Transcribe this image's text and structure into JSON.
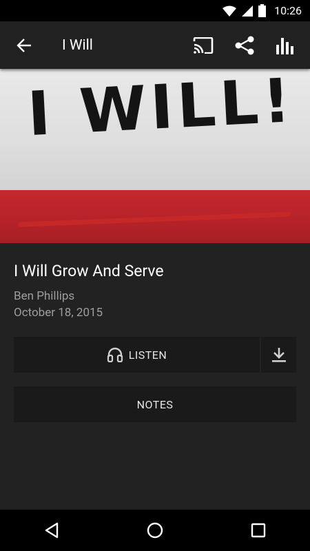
{
  "status_bar": {
    "time": "10:26"
  },
  "app_bar": {
    "title": "I Will"
  },
  "hero": {
    "scribble_text": "I WILL!"
  },
  "sermon": {
    "title": "I Will Grow And Serve",
    "speaker": "Ben Phillips",
    "date": "October 18, 2015"
  },
  "actions": {
    "listen_label": "LISTEN",
    "notes_label": "NOTES"
  },
  "icons": {
    "back": "arrow-back-icon",
    "cast": "cast-icon",
    "share": "share-icon",
    "stats": "bar-chart-icon",
    "headphones": "headphones-icon",
    "download": "download-icon"
  }
}
